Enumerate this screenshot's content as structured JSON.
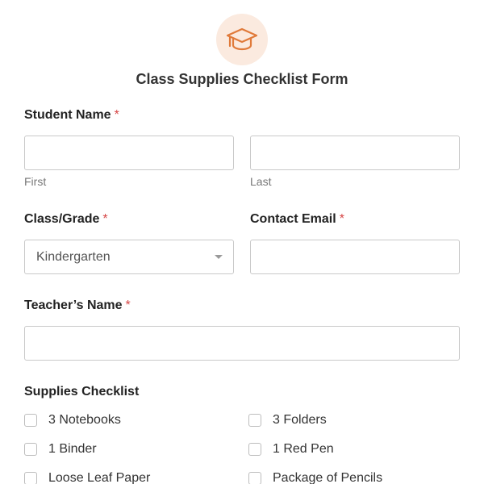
{
  "header": {
    "icon": "graduation-cap-icon",
    "accent_color": "#e07a3a",
    "icon_background": "#fbeadf",
    "title": "Class Supplies Checklist Form"
  },
  "fields": {
    "student_name": {
      "label": "Student Name",
      "required_mark": "*",
      "first": {
        "value": "",
        "sublabel": "First"
      },
      "last": {
        "value": "",
        "sublabel": "Last"
      }
    },
    "class_grade": {
      "label": "Class/Grade",
      "required_mark": "*",
      "selected": "Kindergarten"
    },
    "contact_email": {
      "label": "Contact Email",
      "required_mark": "*",
      "value": ""
    },
    "teacher_name": {
      "label": "Teacher’s Name",
      "required_mark": "*",
      "value": ""
    }
  },
  "supplies": {
    "label": "Supplies Checklist",
    "items": [
      {
        "label": "3 Notebooks",
        "checked": false
      },
      {
        "label": "3 Folders",
        "checked": false
      },
      {
        "label": "1 Binder",
        "checked": false
      },
      {
        "label": "1 Red Pen",
        "checked": false
      },
      {
        "label": "Loose Leaf Paper",
        "checked": false
      },
      {
        "label": "Package of Pencils",
        "checked": false
      }
    ]
  }
}
